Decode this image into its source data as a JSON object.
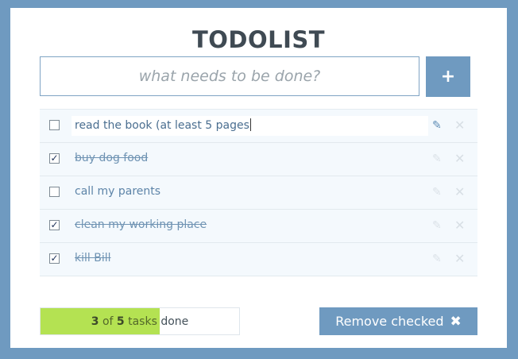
{
  "app": {
    "title": "TODOLIST"
  },
  "new_task": {
    "placeholder": "what needs to be done?",
    "add_label": "+"
  },
  "tasks": [
    {
      "text": "read the book (at least 5 pages",
      "done": false,
      "editing": true
    },
    {
      "text": "buy dog food",
      "done": true,
      "editing": false
    },
    {
      "text": "call my parents",
      "done": false,
      "editing": false
    },
    {
      "text": "clean my working place",
      "done": true,
      "editing": false
    },
    {
      "text": "kill Bill",
      "done": true,
      "editing": false
    }
  ],
  "icons": {
    "edit": "pencil-icon",
    "delete": "close-icon",
    "checkbox_checked": "checkmark-icon"
  },
  "progress": {
    "done_count": "3",
    "of_word": "of",
    "total": "5",
    "tasks_word": "tasks",
    "done_word": "done",
    "fraction": 0.6
  },
  "footer": {
    "remove_label": "Remove checked",
    "remove_icon": "✖"
  },
  "colors": {
    "frame": "#6f9ac0",
    "accent": "#6f9ac0",
    "progress_fill": "#b4e252",
    "task_text": "#5d84a8"
  }
}
